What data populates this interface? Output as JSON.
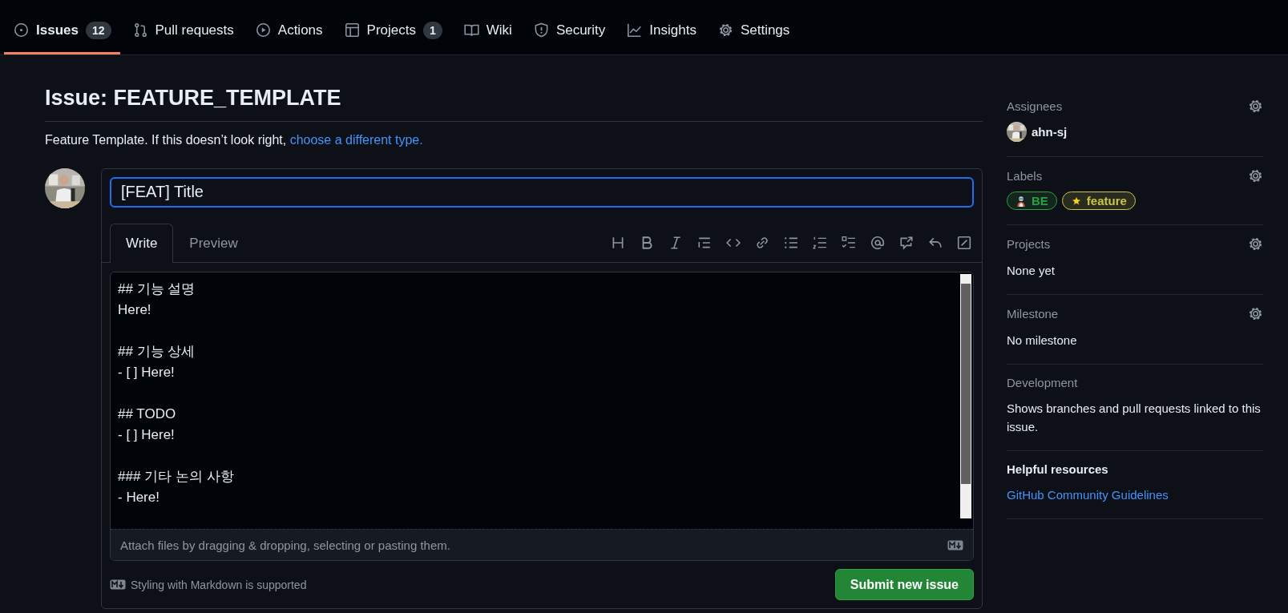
{
  "nav": [
    {
      "label": "Issues",
      "count": "12",
      "selected": true
    },
    {
      "label": "Pull requests",
      "selected": false
    },
    {
      "label": "Actions",
      "selected": false
    },
    {
      "label": "Projects",
      "count": "1",
      "selected": false
    },
    {
      "label": "Wiki",
      "selected": false
    },
    {
      "label": "Security",
      "selected": false
    },
    {
      "label": "Insights",
      "selected": false
    },
    {
      "label": "Settings",
      "selected": false
    }
  ],
  "heading": "Issue: FEATURE_TEMPLATE",
  "template_note": {
    "text": "Feature Template. If this doesn’t look right, ",
    "link": "choose a different type."
  },
  "form": {
    "title_value": "[FEAT] Title",
    "tabs": [
      {
        "label": "Write",
        "selected": true
      },
      {
        "label": "Preview",
        "selected": false
      }
    ],
    "body_value": "## 기능 설명\nHere!\n\n## 기능 상세\n- [ ] Here!\n\n## TODO\n- [ ] Here!\n\n### 기타 논의 사항\n- Here!",
    "attach_hint": "Attach files by dragging & dropping, selecting or pasting them.",
    "markdown_note": "Styling with Markdown is supported",
    "submit": "Submit new issue"
  },
  "sidebar": [
    {
      "kind": "assignees",
      "title": "Assignees",
      "user": "ahn-sj"
    },
    {
      "kind": "labels",
      "title": "Labels",
      "labels": [
        {
          "name": "BE",
          "color": "#2ea043"
        },
        {
          "name": "feature",
          "color": "#c9c34a"
        }
      ]
    },
    {
      "kind": "text",
      "title": "Projects",
      "value": "None yet"
    },
    {
      "kind": "text",
      "title": "Milestone",
      "value": "No milestone"
    },
    {
      "kind": "text",
      "title": "Development",
      "value": "Shows branches and pull requests linked to this issue."
    },
    {
      "kind": "links",
      "title": "Helpful resources",
      "value": "GitHub Community Guidelines"
    }
  ]
}
